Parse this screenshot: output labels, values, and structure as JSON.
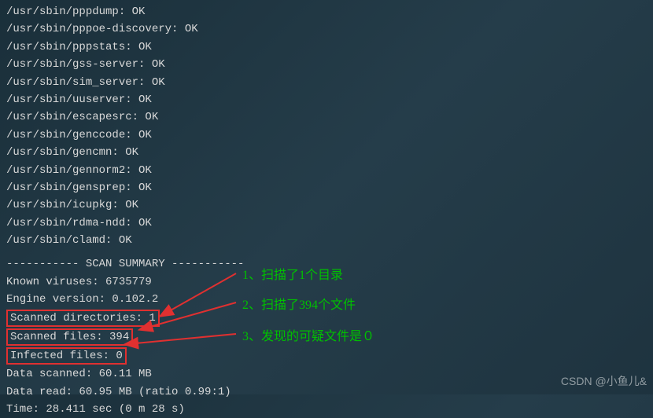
{
  "scan_lines": [
    "/usr/sbin/pppdump: OK",
    "/usr/sbin/pppoe-discovery: OK",
    "/usr/sbin/pppstats: OK",
    "/usr/sbin/gss-server: OK",
    "/usr/sbin/sim_server: OK",
    "/usr/sbin/uuserver: OK",
    "/usr/sbin/escapesrc: OK",
    "/usr/sbin/genccode: OK",
    "/usr/sbin/gencmn: OK",
    "/usr/sbin/gennorm2: OK",
    "/usr/sbin/gensprep: OK",
    "/usr/sbin/icupkg: OK",
    "/usr/sbin/rdma-ndd: OK",
    "/usr/sbin/clamd: OK"
  ],
  "summary_header": "----------- SCAN SUMMARY -----------",
  "summary": {
    "known_viruses": "Known viruses: 6735779",
    "engine_version": "Engine version: 0.102.2",
    "scanned_directories": "Scanned directories: 1",
    "scanned_files": "Scanned files: 394",
    "infected_files": "Infected files: 0",
    "data_scanned": "Data scanned: 60.11 MB",
    "data_read": "Data read: 60.95 MB (ratio 0.99:1)",
    "time": "Time: 28.411 sec (0 m 28 s)"
  },
  "annotations": {
    "a1": "1、扫描了1个目录",
    "a2": "2、扫描了394个文件",
    "a3": "3、发现的可疑文件是０"
  },
  "watermark": "CSDN @小鱼儿&"
}
